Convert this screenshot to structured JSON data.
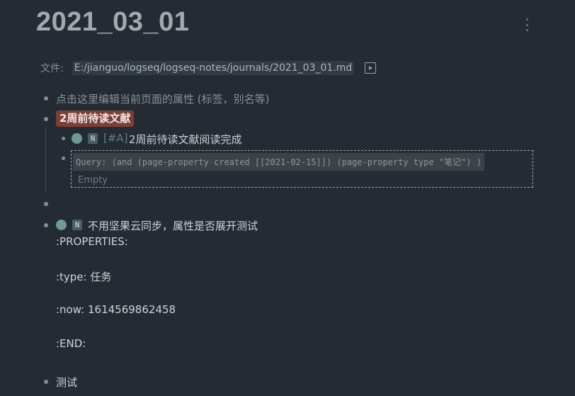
{
  "page": {
    "title": "2021_03_01",
    "file_label": "文件:",
    "file_path": "E:/jianguo/logseq/logseq-notes/journals/2021_03_01.md"
  },
  "icons": {
    "more": "vertical-dots-icon",
    "open_file": "play-icon",
    "todo": "circle-icon"
  },
  "blocks": {
    "properties_hint": "点击这里编辑当前页面的属性 (标签，别名等)",
    "tag": "2周前待读文献",
    "child_todo": {
      "marker": "N",
      "priority": "[#A]",
      "text": "2周前待读文献阅读完成"
    },
    "query": {
      "code": "Query: (and (page-property created [[2021-02-15]]) (page-property type \"笔记\") )",
      "result": "Empty"
    },
    "todo2": {
      "marker": "N",
      "text": "不用坚果云同步，属性是否展开测试",
      "lines": [
        ":PROPERTIES:",
        ":type: 任务",
        ":now: 1614569862458",
        ":END:"
      ]
    },
    "last": "测试"
  },
  "colors": {
    "background": "#252b33",
    "tag_bg": "#7c3f38",
    "todo_circle": "#6e9a91"
  }
}
